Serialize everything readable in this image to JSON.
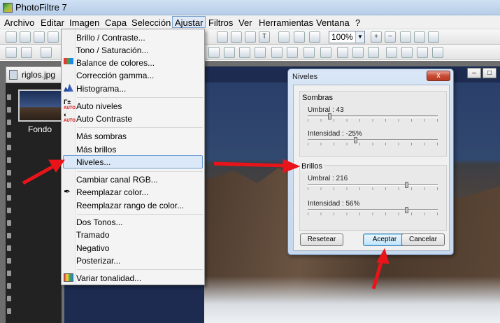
{
  "window": {
    "title": "PhotoFiltre 7"
  },
  "menubar": [
    "Archivo",
    "Editar",
    "Imagen",
    "Capa",
    "Selección",
    "Ajustar",
    "Filtros",
    "Ver",
    "Herramientas",
    "Ventana",
    "?"
  ],
  "toolbar": {
    "zoom": "100%"
  },
  "document": {
    "tab_label": "riglos.jpg",
    "thumbnail_label": "Fondo"
  },
  "adjust_menu": {
    "items": [
      "Brillo / Contraste...",
      "Tono / Saturación...",
      "Balance de colores...",
      "Corrección gamma...",
      "Histograma...",
      "Auto niveles",
      "Auto Contraste",
      "Más sombras",
      "Más brillos",
      "Niveles...",
      "Cambiar canal RGB...",
      "Reemplazar color...",
      "Reemplazar rango de color...",
      "Dos Tonos...",
      "Tramado",
      "Negativo",
      "Posterizar...",
      "Variar tonalidad..."
    ],
    "highlighted": "Niveles..."
  },
  "levels_dialog": {
    "title": "Niveles",
    "close_label": "x",
    "sombras": {
      "label": "Sombras",
      "umbral_label": "Umbral : 43",
      "umbral_value": 43,
      "intensidad_label": "Intensidad : -25%",
      "intensidad_value": -25
    },
    "brillos": {
      "label": "Brillos",
      "umbral_label": "Umbral : 216",
      "umbral_value": 216,
      "intensidad_label": "Intensidad : 56%",
      "intensidad_value": 56
    },
    "buttons": {
      "reset": "Resetear",
      "ok": "Aceptar",
      "cancel": "Cancelar"
    }
  },
  "colors": {
    "arrow": "#e8141a",
    "menu_highlight": "#dbe8f7",
    "dialog_close": "#c74a32"
  }
}
